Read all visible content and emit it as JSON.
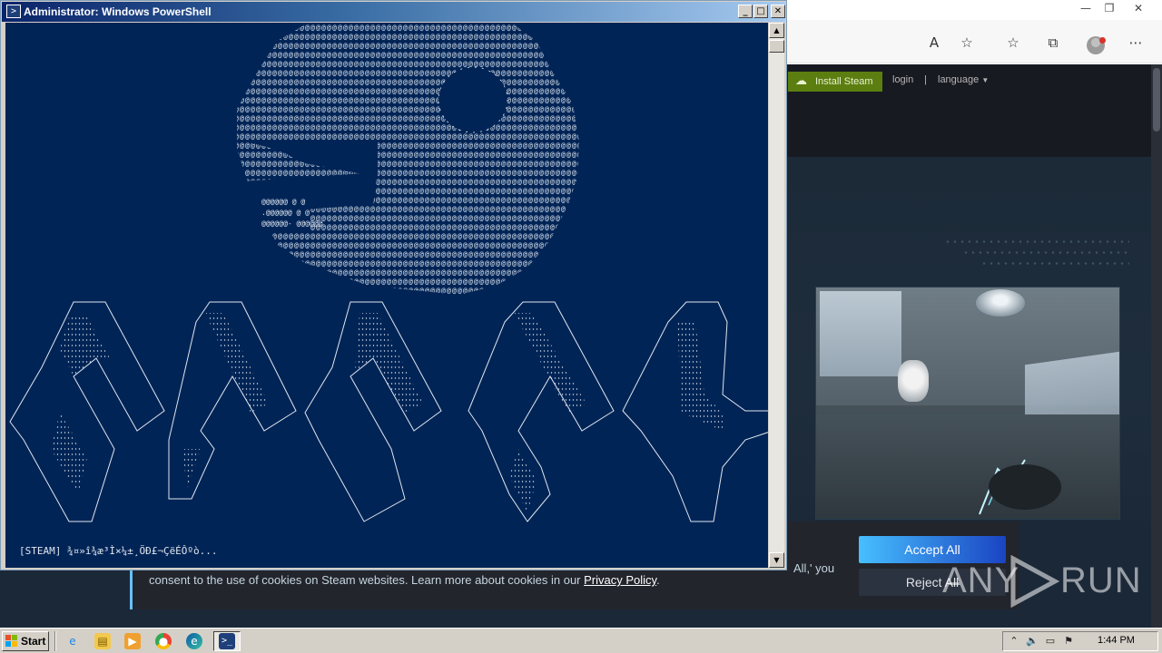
{
  "powershell": {
    "title": "Administrator: Windows PowerShell",
    "icon": "powershell-icon",
    "controls": [
      "minimize",
      "maximize",
      "close"
    ],
    "output_line": "[STEAM] ¾¤»î¾æ³Ì×¼±¸ÖÐ£¬ÇëÉÔºò..."
  },
  "browser": {
    "toolbar_icons": [
      "read-aloud-icon",
      "add-favorite-icon",
      "favorites-icon",
      "collections-icon",
      "profile-icon",
      "more-icon"
    ]
  },
  "steam": {
    "install_label": "Install Steam",
    "login_label": "login",
    "separator": "|",
    "language_label": "language"
  },
  "cookie": {
    "text_tail": "All,' you",
    "text_line": "consent to the use of cookies on Steam websites. Learn more about cookies in our",
    "privacy_link": "Privacy Policy",
    "text_end": ".",
    "accept_label": "Accept All",
    "reject_label": "Reject All"
  },
  "watermark": {
    "left": "ANY",
    "right": "RUN"
  },
  "taskbar": {
    "start_label": "Start",
    "quick_launch": [
      "ie-icon",
      "explorer-icon",
      "media-player-icon",
      "chrome-icon",
      "edge-icon"
    ],
    "active_task": "powershell-task",
    "clock": "1:44 PM"
  },
  "colors": {
    "console_bg": "#012456",
    "steam_bg": "#1b2838",
    "install_green": "#5c7e10",
    "accept_blue": "#47bfff"
  }
}
